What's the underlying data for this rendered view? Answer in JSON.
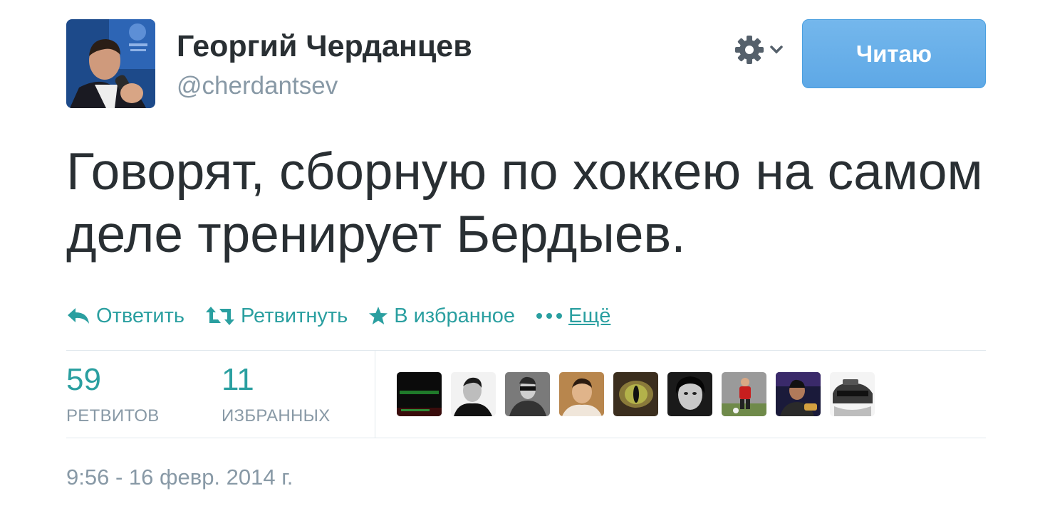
{
  "author": {
    "name": "Георгий Черданцев",
    "handle": "@cherdantsev"
  },
  "follow_button": {
    "label": "Читаю"
  },
  "settings_menu": {
    "icon": "gear-icon",
    "caret": "chevron-down-icon"
  },
  "tweet": {
    "text": "Говорят, сборную по хоккею на самом деле тренирует Бердыев.",
    "timestamp": "9:56 - 16 февр. 2014 г."
  },
  "actions": {
    "reply": "Ответить",
    "retweet": "Ретвитнуть",
    "favorite": "В избранное",
    "more": "Ещё"
  },
  "stats": {
    "retweets": {
      "count": "59",
      "label": "РЕТВИТОВ"
    },
    "favorites": {
      "count": "11",
      "label": "ИЗБРАННЫХ"
    }
  },
  "colors": {
    "accent": "#2a9fa0",
    "button": "#5ea8e6",
    "text": "#292f33",
    "muted": "#8899a6"
  },
  "favoriters_count_shown": 9
}
